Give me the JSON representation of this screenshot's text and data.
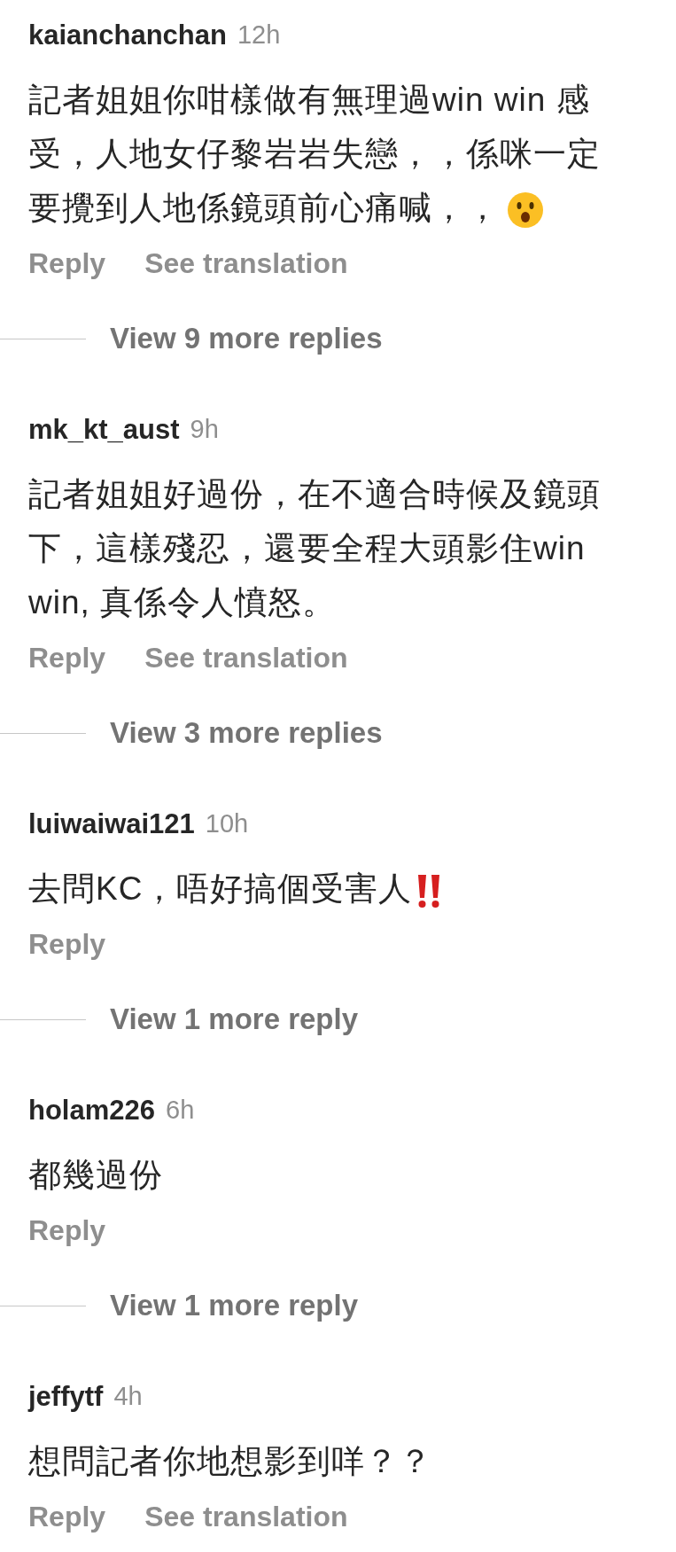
{
  "comments": [
    {
      "username": "kaianchanchan",
      "time": "12h",
      "lines": [
        "記者姐姐你咁樣做有無理過win win 感",
        "受，人地女仔黎岩岩失戀，，係咪一定",
        "要攪到人地係鏡頭前心痛喊，，"
      ],
      "trailing_icon": {
        "kind": "surprised"
      },
      "actions": [
        "Reply",
        "See translation"
      ],
      "view_replies": "View 9 more replies"
    },
    {
      "username": "mk_kt_aust",
      "time": "9h",
      "lines": [
        "記者姐姐好過份，在不適合時候及鏡頭",
        "下，這樣殘忍，還要全程大頭影住win",
        "win, 真係令人憤怒。"
      ],
      "actions": [
        "Reply",
        "See translation"
      ],
      "view_replies": "View 3 more replies"
    },
    {
      "username": "luiwaiwai121",
      "time": "10h",
      "lines": [
        "去問KC，唔好搞個受害人"
      ],
      "trailing_icon": {
        "kind": "exclamation"
      },
      "actions": [
        "Reply"
      ],
      "view_replies": "View 1 more reply"
    },
    {
      "username": "holam226",
      "time": "6h",
      "lines": [
        "都幾過份"
      ],
      "actions": [
        "Reply"
      ],
      "view_replies": "View 1 more reply"
    },
    {
      "username": "jeffytf",
      "time": "4h",
      "lines": [
        "想問記者你地想影到咩？？"
      ],
      "actions": [
        "Reply",
        "See translation"
      ]
    }
  ]
}
